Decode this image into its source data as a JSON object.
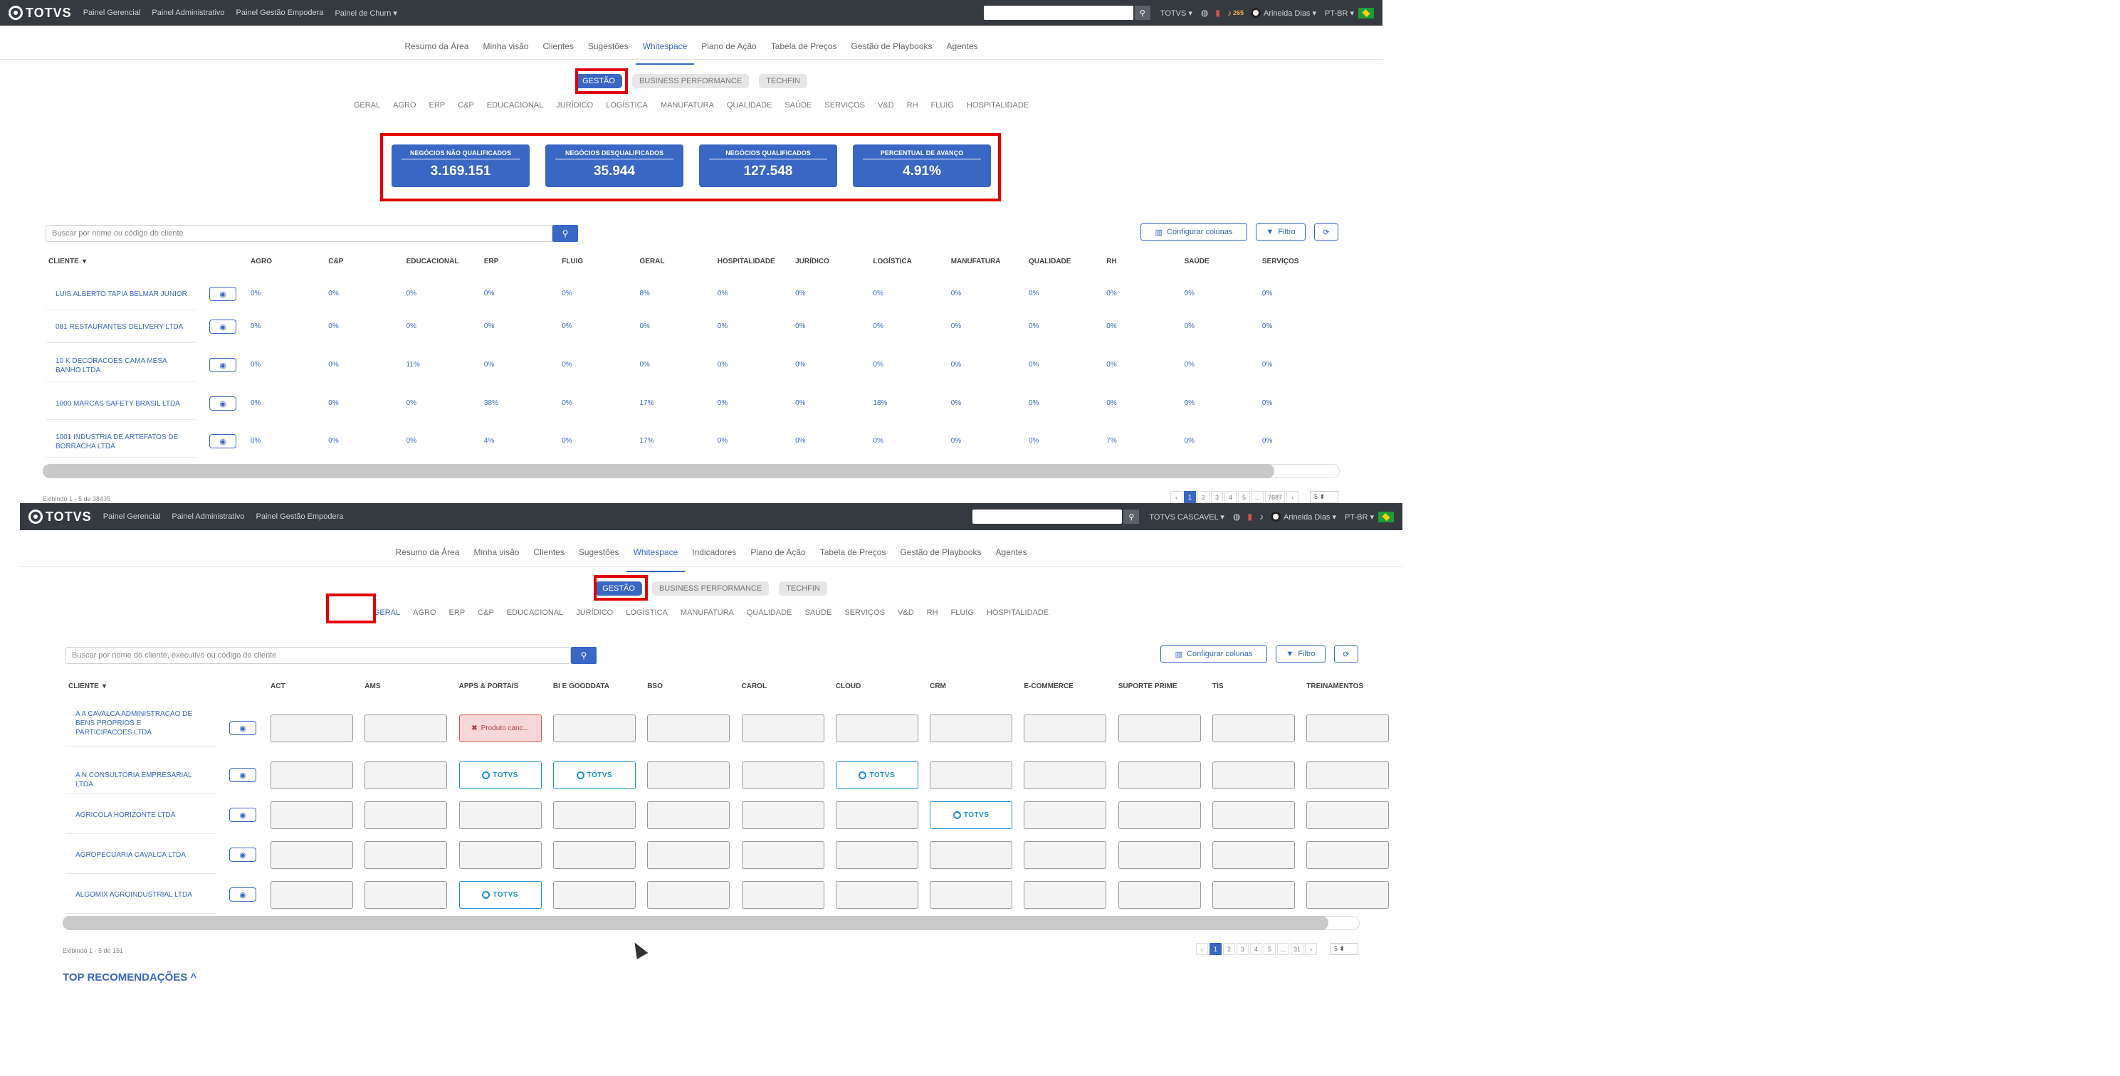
{
  "screen1": {
    "topbar": {
      "logo": "TOTVS",
      "nav": [
        "Painel Gerencial",
        "Painel Administrativo",
        "Painel Gestão Empodera",
        "Painel de Churn ▾"
      ],
      "search_placeholder": "",
      "company": "TOTVS ▾",
      "notif_count": "265",
      "user": "Arineida Dias ▾",
      "lang": "PT-BR ▾"
    },
    "tabs": [
      "Resumo da Área",
      "Minha visão",
      "Clientes",
      "Sugestões",
      "Whitespace",
      "Plano de Ação",
      "Tabela de Preços",
      "Gestão de Playbooks",
      "Agentes"
    ],
    "active_tab": "Whitespace",
    "pills": [
      "GESTÃO",
      "BUSINESS PERFORMANCE",
      "TECHFIN"
    ],
    "categories": [
      "GERAL",
      "AGRO",
      "ERP",
      "C&P",
      "EDUCACIONAL",
      "JURÍDICO",
      "LOGÍSTICA",
      "MANUFATURA",
      "QUALIDADE",
      "SAÚDE",
      "SERVIÇOS",
      "V&D",
      "RH",
      "FLUIG",
      "HOSPITALIDADE"
    ],
    "kpis": [
      {
        "title": "NEGÓCIOS NÃO QUALIFICADOS",
        "value": "3.169.151"
      },
      {
        "title": "NEGÓCIOS DESQUALIFICADOS",
        "value": "35.944"
      },
      {
        "title": "NEGÓCIOS QUALIFICADOS",
        "value": "127.548"
      },
      {
        "title": "PERCENTUAL DE AVANÇO",
        "value": "4.91%"
      }
    ],
    "search_placeholder": "Buscar por nome ou código do cliente",
    "configure_label": "Configurar colunas",
    "filter_label": "Filtro",
    "columns": [
      "CLIENTE",
      "AGRO",
      "C&P",
      "EDUCACIONAL",
      "ERP",
      "FLUIG",
      "GERAL",
      "HOSPITALIDADE",
      "JURÍDICO",
      "LOGÍSTICA",
      "MANUFATURA",
      "QUALIDADE",
      "RH",
      "SAÚDE",
      "SERVIÇOS"
    ],
    "rows": [
      {
        "name": "LUIS ALBERTO TAPIA BELMAR JUNIOR",
        "values": [
          "0%",
          "0%",
          "0%",
          "0%",
          "0%",
          "8%",
          "0%",
          "0%",
          "0%",
          "0%",
          "0%",
          "0%",
          "0%",
          "0%"
        ]
      },
      {
        "name": "081 RESTAURANTES DELIVERY LTDA",
        "values": [
          "0%",
          "0%",
          "0%",
          "0%",
          "0%",
          "0%",
          "0%",
          "0%",
          "0%",
          "0%",
          "0%",
          "0%",
          "0%",
          "0%"
        ]
      },
      {
        "name": "10 K DECORACOES CAMA MESA BANHO LTDA",
        "values": [
          "0%",
          "0%",
          "11%",
          "0%",
          "0%",
          "0%",
          "0%",
          "0%",
          "0%",
          "0%",
          "0%",
          "0%",
          "0%",
          "0%"
        ]
      },
      {
        "name": "1000 MARCAS SAFETY BRASIL LTDA",
        "values": [
          "0%",
          "0%",
          "0%",
          "38%",
          "0%",
          "17%",
          "0%",
          "0%",
          "18%",
          "0%",
          "0%",
          "0%",
          "0%",
          "0%"
        ]
      },
      {
        "name": "1001 INDUSTRIA DE ARTEFATOS DE BORRACHA LTDA",
        "values": [
          "0%",
          "0%",
          "0%",
          "4%",
          "0%",
          "17%",
          "0%",
          "0%",
          "0%",
          "0%",
          "0%",
          "7%",
          "0%",
          "0%"
        ]
      }
    ],
    "footer_count": "Exibindo 1 - 5 de 38435",
    "pages": [
      "‹",
      "1",
      "2",
      "3",
      "4",
      "5",
      "...",
      "7687",
      "›"
    ],
    "per_page": "5 ⬍"
  },
  "screen2": {
    "topbar": {
      "logo": "TOTVS",
      "nav": [
        "Painel Gerencial",
        "Painel Administrativo",
        "Painel Gestão Empodera"
      ],
      "company": "TOTVS CASCAVEL ▾",
      "user": "Arineida Dias ▾",
      "lang": "PT-BR ▾"
    },
    "tabs": [
      "Resumo da Área",
      "Minha visão",
      "Clientes",
      "Sugestões",
      "Whitespace",
      "Indicadores",
      "Plano de Ação",
      "Tabela de Preços",
      "Gestão de Playbooks",
      "Agentes"
    ],
    "active_tab": "Whitespace",
    "pills": [
      "GESTÃO",
      "BUSINESS PERFORMANCE",
      "TECHFIN"
    ],
    "categories": [
      "GERAL",
      "AGRO",
      "ERP",
      "C&P",
      "EDUCACIONAL",
      "JURÍDICO",
      "LOGÍSTICA",
      "MANUFATURA",
      "QUALIDADE",
      "SAÚDE",
      "SERVIÇOS",
      "V&D",
      "RH",
      "FLUIG",
      "HOSPITALIDADE"
    ],
    "search_placeholder": "Buscar por nome do cliente, executivo ou código do cliente",
    "configure_label": "Configurar colunas",
    "filter_label": "Filtro",
    "columns": [
      "CLIENTE",
      "ACT",
      "AMS",
      "APPS & PORTAIS",
      "BI E GOODDATA",
      "BSO",
      "CAROL",
      "CLOUD",
      "CRM",
      "E-COMMERCE",
      "SUPORTE PRIME",
      "TIS",
      "TREINAMENTOS"
    ],
    "product_label": "TOTVS",
    "cancel_label": "Produto canc...",
    "rows": [
      {
        "name": "A A CAVALCA ADMINISTRACAO DE BENS PROPRIOS E PARTICIPACOES LTDA",
        "cells": [
          "",
          "",
          "cancel",
          "",
          "",
          "",
          "",
          "",
          "",
          "",
          "",
          ""
        ]
      },
      {
        "name": "A N CONSULTORIA EMPRESARIAL LTDA",
        "cells": [
          "",
          "",
          "totvs",
          "totvs",
          "",
          "",
          "totvs",
          "",
          "",
          "",
          "",
          ""
        ]
      },
      {
        "name": "AGRICOLA HORIZONTE LTDA",
        "cells": [
          "",
          "",
          "",
          "",
          "",
          "",
          "",
          "totvs",
          "",
          "",
          "",
          ""
        ]
      },
      {
        "name": "AGROPECUARIA CAVALCA LTDA",
        "cells": [
          "",
          "",
          "",
          "",
          "",
          "",
          "",
          "",
          "",
          "",
          "",
          ""
        ]
      },
      {
        "name": "ALGOMIX AGROINDUSTRIAL LTDA",
        "cells": [
          "",
          "",
          "totvs",
          "",
          "",
          "",
          "",
          "",
          "",
          "",
          "",
          ""
        ]
      }
    ],
    "footer_count": "Exibindo 1 - 5 de 151",
    "pages": [
      "‹",
      "1",
      "2",
      "3",
      "4",
      "5",
      "...",
      "31",
      "›"
    ],
    "per_page": "5 ⬍",
    "top_recommendations": "TOP RECOMENDAÇÕES ^"
  },
  "colors": {
    "accent": "#3a66c4",
    "topbar": "#343a40",
    "highlight": "#e10000",
    "product": "#1d8fd0"
  }
}
